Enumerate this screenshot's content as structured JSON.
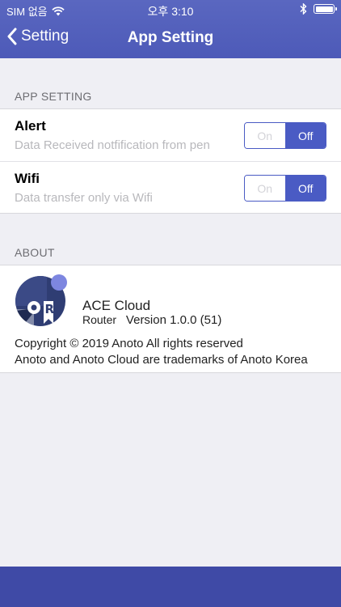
{
  "status_bar": {
    "carrier": "SIM 없음",
    "time": "오후 3:10"
  },
  "nav": {
    "back_label": "Setting",
    "title": "App Setting"
  },
  "app_setting": {
    "section_label": "APP SETTING",
    "rows": [
      {
        "title": "Alert",
        "subtitle": "Data Received notfification from pen",
        "on_label": "On",
        "off_label": "Off",
        "selected": "Off"
      },
      {
        "title": "Wifi",
        "subtitle": "Data transfer only via Wifi",
        "on_label": "On",
        "off_label": "Off",
        "selected": "Off"
      }
    ]
  },
  "about": {
    "section_label": "ABOUT",
    "app_name": "ACE Cloud",
    "app_sub": "Router",
    "version": "Version 1.0.0 (51)",
    "copyright": "Copyright © 2019 Anoto All rights reserved",
    "trademark": "Anoto and Anoto Cloud are trademarks of Anoto Korea"
  },
  "colors": {
    "header": "#5a67c0",
    "accent": "#4a5bc4",
    "tabbar": "#3f4aa6",
    "background": "#efeff4"
  }
}
